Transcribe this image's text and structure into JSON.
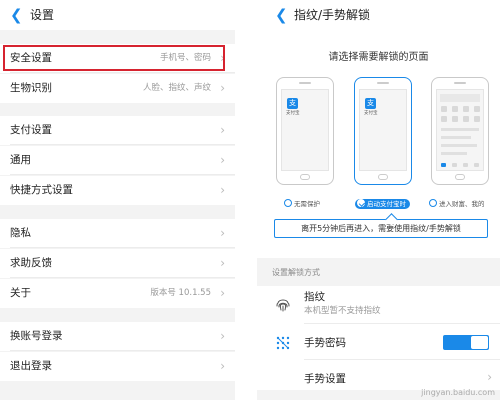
{
  "left": {
    "header": {
      "title": "设置"
    },
    "rows": [
      {
        "label": "安全设置",
        "value": "手机号、密码"
      },
      {
        "label": "生物识别",
        "value": "人脸、指纹、声纹"
      },
      {
        "label": "支付设置",
        "value": ""
      },
      {
        "label": "通用",
        "value": ""
      },
      {
        "label": "快捷方式设置",
        "value": ""
      },
      {
        "label": "隐私",
        "value": ""
      },
      {
        "label": "求助反馈",
        "value": ""
      },
      {
        "label": "关于",
        "value": "版本号 10.1.55"
      },
      {
        "label": "换账号登录",
        "value": ""
      },
      {
        "label": "退出登录",
        "value": ""
      }
    ]
  },
  "right": {
    "header": {
      "title": "指纹/手势解锁"
    },
    "prompt": "请选择需要解锁的页面",
    "app_name": "支付宝",
    "app_icon_glyph": "支",
    "options": [
      {
        "label": "无需保护",
        "selected": false
      },
      {
        "label": "启动支付宝时",
        "selected": true
      },
      {
        "label": "进入财富、我的",
        "selected": false
      }
    ],
    "tooltip": "离开5分钟后再进入，需要使用指纹/手势解锁",
    "section_title": "设置解锁方式",
    "fingerprint": {
      "title": "指纹",
      "subtitle": "本机型暂不支持指纹"
    },
    "gesture_password": {
      "title": "手势密码",
      "enabled": true
    },
    "gesture_settings": {
      "title": "手势设置"
    },
    "watermark": "jingyan.baidu.com"
  },
  "colors": {
    "accent": "#1a89e8",
    "highlight_border": "#d6232f"
  }
}
